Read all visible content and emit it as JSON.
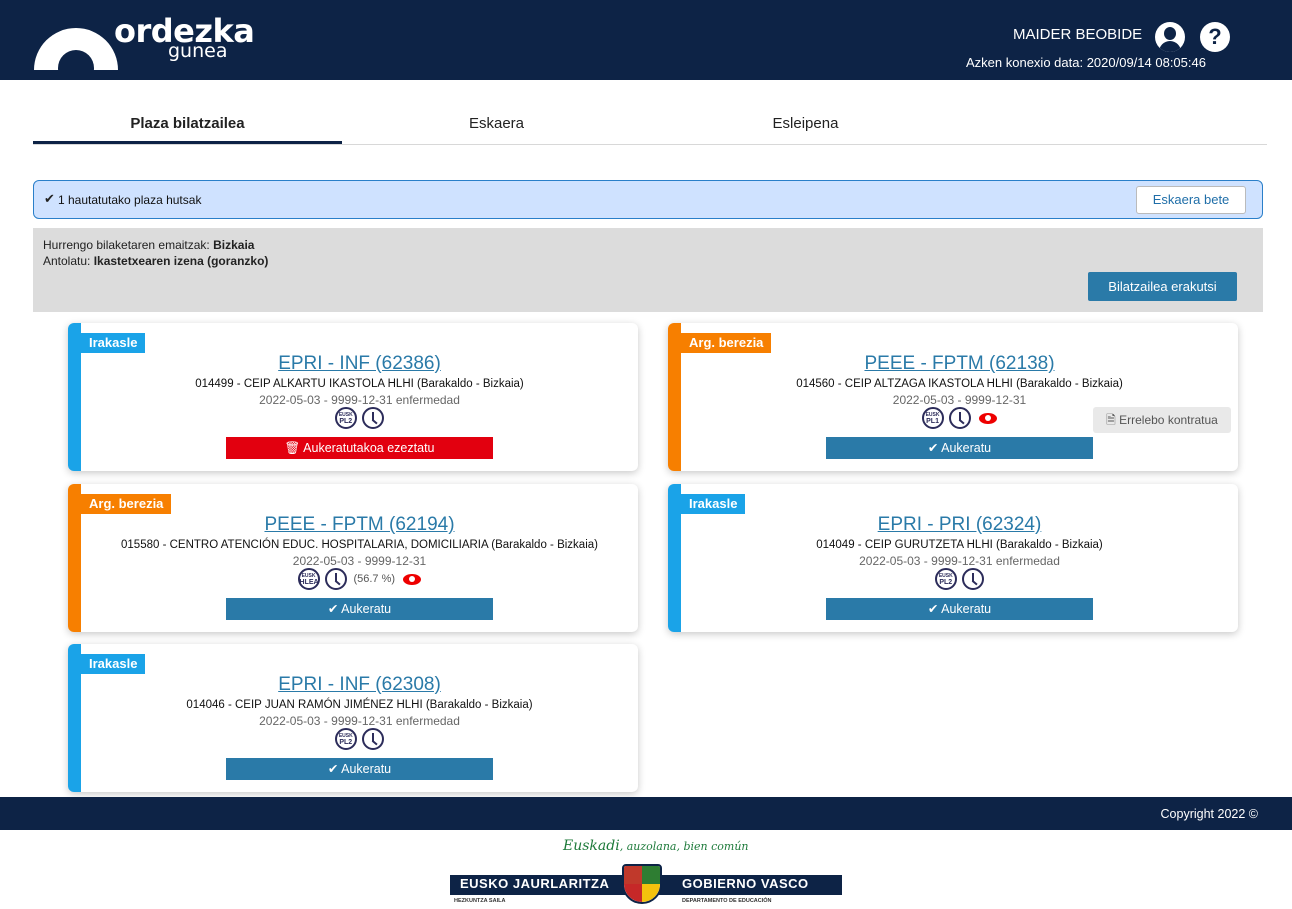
{
  "header": {
    "logo_word1": "ordezka",
    "logo_word2": "gunea",
    "user_name": "MAIDER BEOBIDE",
    "last_connection": "Azken konexio data: 2020/09/14 08:05:46",
    "help_glyph": "?",
    "bg_color": "#0d2346"
  },
  "tabs": [
    {
      "label": "Plaza bilatzailea",
      "active": true
    },
    {
      "label": "Eskaera",
      "active": false
    },
    {
      "label": "Esleipena",
      "active": false
    }
  ],
  "selection_bar": {
    "check_glyph": "✔",
    "text": "1 hautatutako plaza hutsak",
    "button_label": "Eskaera bete"
  },
  "search_info": {
    "results_label": "Hurrengo bilaketaren emaitzak: ",
    "results_value": "Bizkaia",
    "sort_label": "Antolatu: ",
    "sort_value": "Ikastetxearen izena (goranzko)",
    "show_search_button": "Bilatzailea erakutsi"
  },
  "cards": [
    {
      "tag": "Irakasle",
      "tag_color": "#1aa3e8",
      "code": "EPRI - INF (62386)",
      "school": "014499 - CEIP ALKARTU IKASTOLA HLHI (Barakaldo - Bizkaia)",
      "dates": "2022-05-03 - 9999-12-31 enfermedad",
      "lang_top": "EUSK",
      "lang_bottom": "PL2",
      "action": "🗑 Aukeratutakoa ezeztatu",
      "action_style": "red"
    },
    {
      "tag": "Arg. berezia",
      "tag_color": "#f77f00",
      "code": "PEEE - FPTM (62138)",
      "school": "014560 - CEIP ALTZAGA IKASTOLA HLHI (Barakaldo - Bizkaia)",
      "dates": "2022-05-03 - 9999-12-31",
      "lang_top": "EUSK",
      "lang_bottom": "PL1",
      "eye": true,
      "extra_button": "🗎 Errelebo kontratua",
      "action": "✔ Aukeratu",
      "action_style": "blue"
    },
    {
      "tag": "Arg. berezia",
      "tag_color": "#f77f00",
      "code": "PEEE - FPTM (62194)",
      "school": "015580 - CENTRO ATENCIÓN EDUC. HOSPITALARIA, DOMICILIARIA (Barakaldo - Bizkaia)",
      "dates": "2022-05-03 - 9999-12-31",
      "lang_top": "EUSK",
      "lang_bottom": "HLEA",
      "percent": "(56.7 %)",
      "eye": true,
      "action": "✔ Aukeratu",
      "action_style": "blue"
    },
    {
      "tag": "Irakasle",
      "tag_color": "#1aa3e8",
      "code": "EPRI - PRI (62324)",
      "school": "014049 - CEIP GURUTZETA HLHI (Barakaldo - Bizkaia)",
      "dates": "2022-05-03 - 9999-12-31 enfermedad",
      "lang_top": "EUSK",
      "lang_bottom": "PL2",
      "action": "✔ Aukeratu",
      "action_style": "blue"
    },
    {
      "tag": "Irakasle",
      "tag_color": "#1aa3e8",
      "code": "EPRI - INF (62308)",
      "school": "014046 - CEIP JUAN RAMÓN JIMÉNEZ HLHI (Barakaldo - Bizkaia)",
      "dates": "2022-05-03 - 9999-12-31 enfermedad",
      "lang_top": "EUSK",
      "lang_bottom": "PL2",
      "action": "✔ Aukeratu",
      "action_style": "blue"
    }
  ],
  "footer": {
    "copyright": "Copyright 2022 ©",
    "motto_bold": "Euskadi",
    "motto_rest": ", auzolana, bien común",
    "gov_left": "EUSKO JAURLARITZA",
    "gov_right": "GOBIERNO VASCO",
    "dept_left": "HEZKUNTZA SAILA",
    "dept_right": "DEPARTAMENTO DE EDUCACIÓN"
  }
}
